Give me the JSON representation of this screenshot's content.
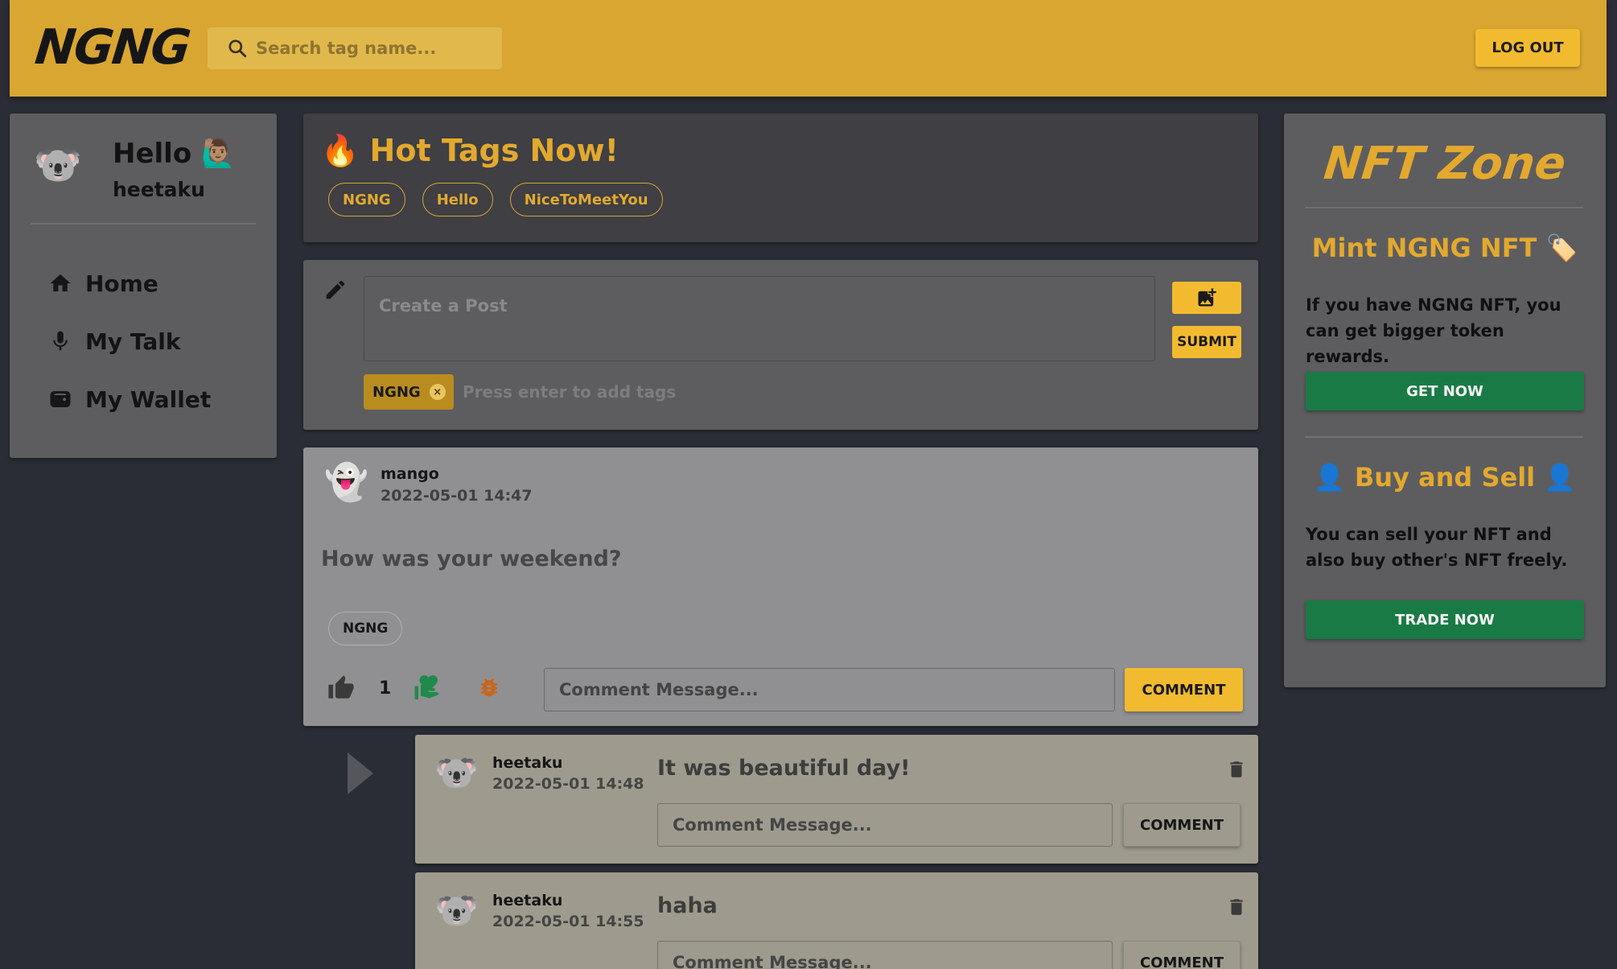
{
  "header": {
    "logo": "NGNG",
    "search_placeholder": "Search tag name...",
    "logout_label": "LOG OUT",
    "bg_color": "#d9a631"
  },
  "sidebar": {
    "avatar": "🐨",
    "greeting": "Hello 🙋🏽‍♂️",
    "username": "heetaku",
    "items": [
      {
        "label": "Home",
        "icon": "home-icon"
      },
      {
        "label": "My Talk",
        "icon": "microphone-icon"
      },
      {
        "label": "My Wallet",
        "icon": "wallet-icon"
      }
    ]
  },
  "hot_tags": {
    "title": "🔥 Hot Tags Now!",
    "tags": [
      "NGNG",
      "Hello",
      "NiceToMeetYou"
    ]
  },
  "create_post": {
    "placeholder": "Create a Post",
    "submit_label": "SUBMIT",
    "selected_tag": "NGNG",
    "tag_placeholder": "Press enter to add tags"
  },
  "post": {
    "avatar": "👻",
    "author": "mango",
    "time": "2022-05-01 14:47",
    "body": "How was your weekend?",
    "tag": "NGNG",
    "like_count": "1",
    "comment_placeholder": "Comment Message...",
    "comment_label": "COMMENT"
  },
  "comments": [
    {
      "avatar": "🐨",
      "author": "heetaku",
      "time": "2022-05-01 14:48",
      "text": "It was beautiful day!",
      "placeholder": "Comment Message...",
      "button": "COMMENT"
    },
    {
      "avatar": "🐨",
      "author": "heetaku",
      "time": "2022-05-01 14:55",
      "text": "haha",
      "placeholder": "Comment Message...",
      "button": "COMMENT"
    }
  ],
  "nft_zone": {
    "title": "NFT Zone",
    "mint_heading": "Mint NGNG NFT 🏷️",
    "mint_desc": "If you have NGNG NFT, you can get bigger token rewards.",
    "get_now_label": "GET NOW",
    "trade_heading": "👤 Buy and Sell 👤",
    "trade_desc": "You can sell your NFT and also buy other's NFT freely.",
    "trade_now_label": "TRADE NOW"
  }
}
